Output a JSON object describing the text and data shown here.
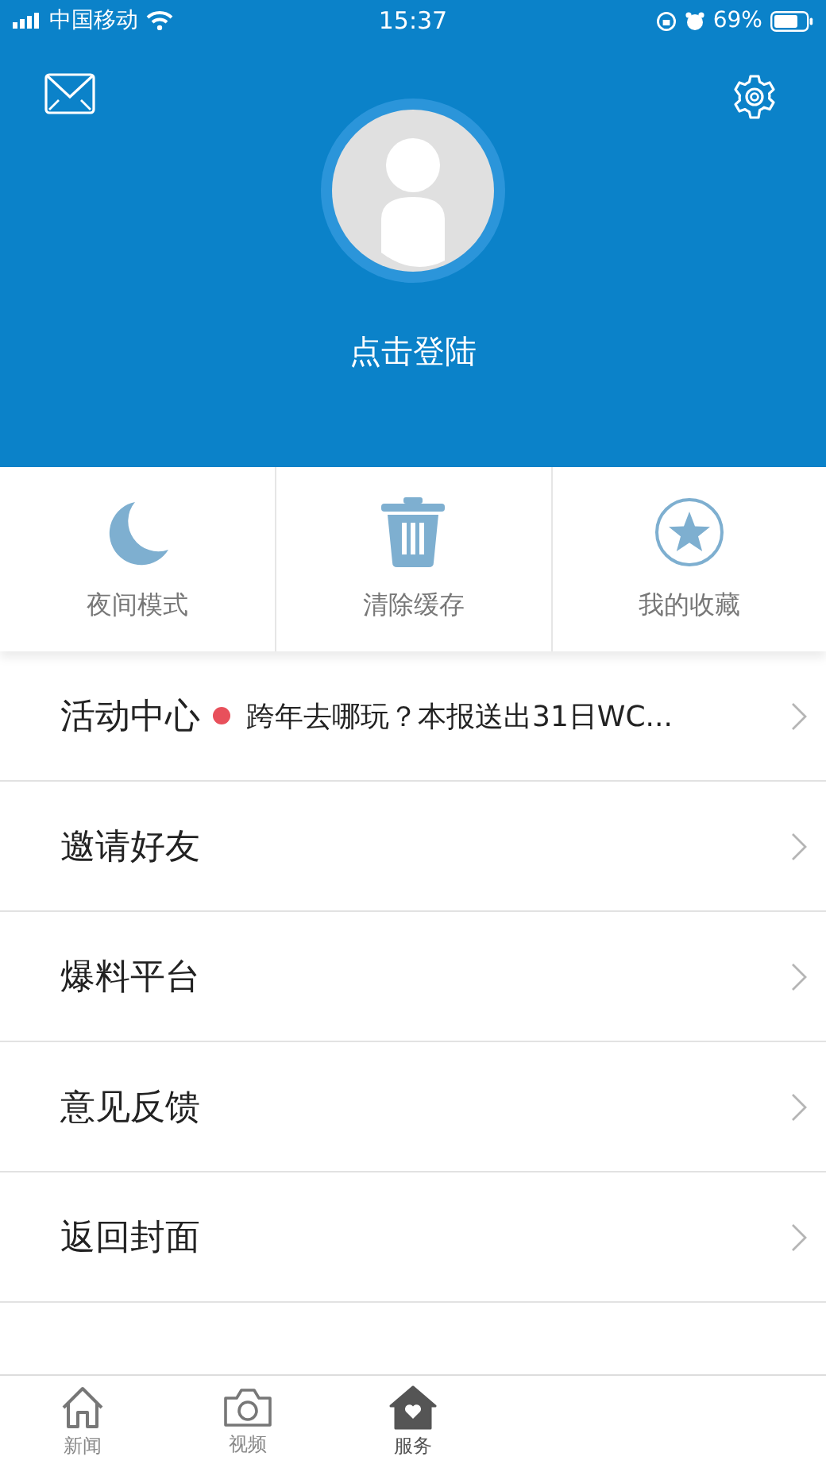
{
  "status_bar": {
    "carrier": "中国移动",
    "time": "15:37",
    "battery": "69%"
  },
  "profile": {
    "login_label": "点击登陆"
  },
  "quick_actions": [
    {
      "kind": "moon",
      "label": "夜间模式"
    },
    {
      "kind": "trash",
      "label": "清除缓存"
    },
    {
      "kind": "star",
      "label": "我的收藏"
    }
  ],
  "menu": [
    {
      "label": "活动中心",
      "unread": true,
      "detail": "跨年去哪玩？本报送出31日WC..."
    },
    {
      "label": "邀请好友",
      "unread": false
    },
    {
      "label": "爆料平台",
      "unread": false
    },
    {
      "label": "意见反馈",
      "unread": false
    },
    {
      "label": "返回封面",
      "unread": false
    }
  ],
  "tab_bar": [
    {
      "kind": "home",
      "label": "新闻",
      "selected": false
    },
    {
      "kind": "camera",
      "label": "视频",
      "selected": false
    },
    {
      "kind": "service",
      "label": "服务",
      "selected": true
    }
  ]
}
